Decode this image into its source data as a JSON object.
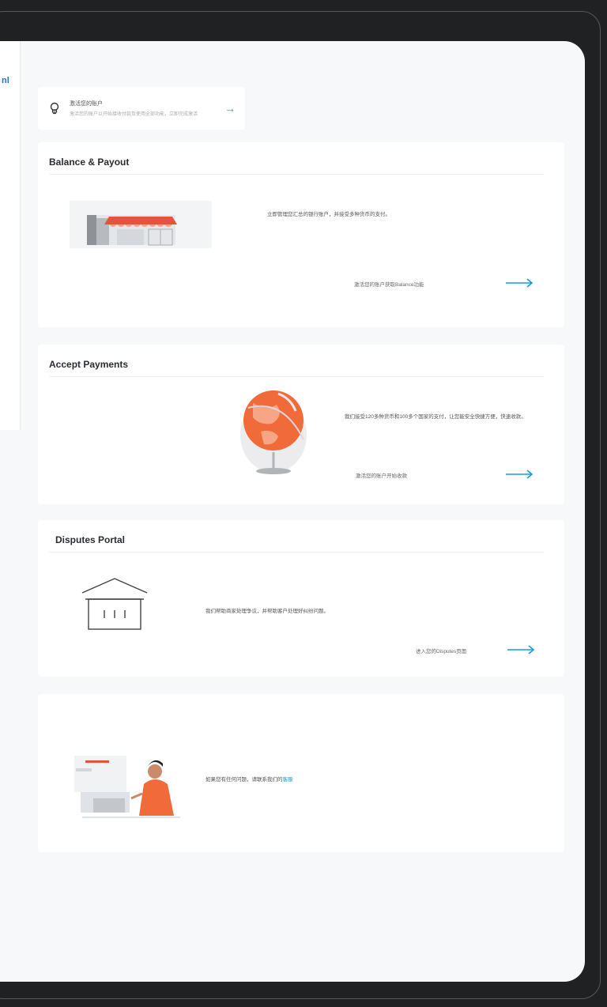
{
  "sidebar": {
    "fragment": "nl"
  },
  "banner": {
    "title": "激活您的账户",
    "subtitle": "激活您的账户以开始接收付款及使用全部功能，立即完成激活",
    "arrow": "→"
  },
  "cards": {
    "balance": {
      "title": "Balance & Payout",
      "description": "立即管理您汇总的银行账户，并接受多种货币的支付。",
      "link": "激活您的账户获取Balance功能"
    },
    "payments": {
      "title": "Accept Payments",
      "description": "我们接受120多种货币和100多个国家的支付，让您能安全快捷方便，快速收款。",
      "link": "激活您的账户开始收款"
    },
    "disputes": {
      "title": "Disputes Portal",
      "description": "我们帮助商家处理争议，并帮助客户处理好纠纷问题。",
      "link": "进入您的Disputes页面"
    }
  },
  "support": {
    "text": "如果您有任何问题，请联系我们的",
    "link": "客服"
  },
  "colors": {
    "accent": "#1b9ad6",
    "orange": "#f06a3a",
    "frame": "#1f2123",
    "background": "#f6f8fa"
  }
}
